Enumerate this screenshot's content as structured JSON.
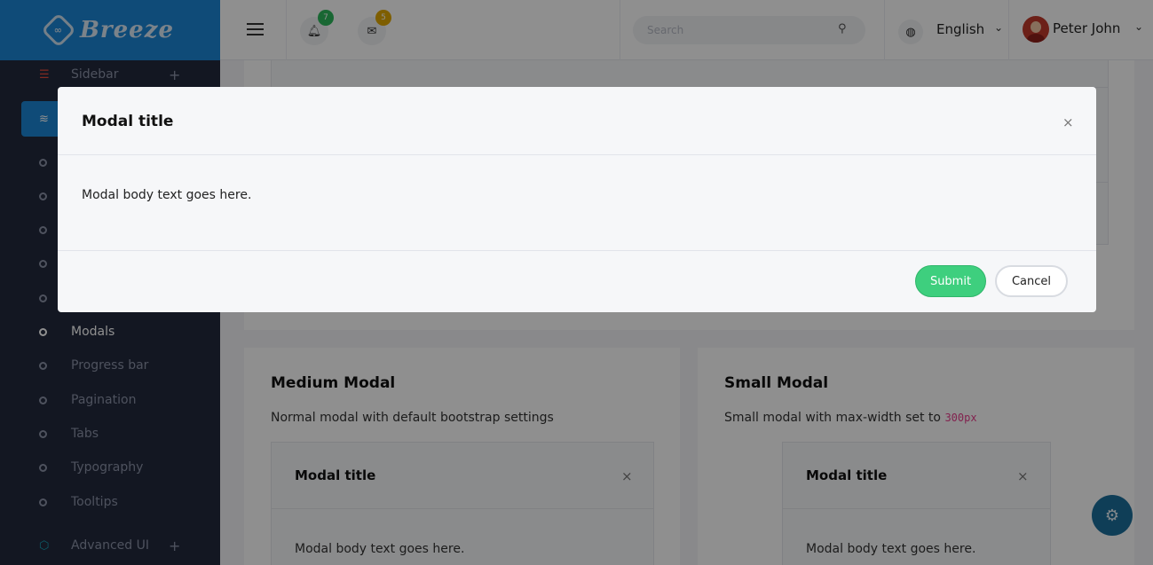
{
  "brand": {
    "name": "Breeze",
    "logo_glyph": "∞"
  },
  "sidebar": {
    "items": [
      {
        "label": "Sidebar",
        "icon": "list-icon",
        "expandable": true
      },
      {
        "label": "",
        "icon": "layers-icon",
        "active": true
      },
      {
        "label": ""
      },
      {
        "label": ""
      },
      {
        "label": ""
      },
      {
        "label": ""
      },
      {
        "label": ""
      },
      {
        "label": "Modals",
        "active": true
      },
      {
        "label": "Progress bar"
      },
      {
        "label": "Pagination"
      },
      {
        "label": "Tabs"
      },
      {
        "label": "Typography"
      },
      {
        "label": "Tooltips"
      },
      {
        "label": "Advanced UI",
        "icon": "cube-icon",
        "expandable": true
      }
    ]
  },
  "topbar": {
    "notifications": {
      "icon": "bell-icon",
      "count": "7",
      "badge_color": "#2eb85c"
    },
    "messages": {
      "icon": "mail-icon",
      "count": "5",
      "badge_color": "#e0a800"
    },
    "search": {
      "placeholder": "Search",
      "icon": "search-icon"
    },
    "language": {
      "icon": "globe-icon",
      "label": "English"
    },
    "user": {
      "name": "Peter John"
    }
  },
  "cards": {
    "medium": {
      "title": "Medium Modal",
      "description": "Normal modal with default bootstrap settings",
      "modal_title": "Modal title",
      "modal_body": "Modal body text goes here."
    },
    "small": {
      "title": "Small Modal",
      "description_prefix": "Small modal with max-width set to ",
      "description_code": "300px",
      "modal_title": "Modal title",
      "modal_body": "Modal body text goes here."
    }
  },
  "modal": {
    "title": "Modal title",
    "close": "×",
    "body": "Modal body text goes here.",
    "submit_label": "Submit",
    "cancel_label": "Cancel"
  },
  "colors": {
    "accent": "#1b87d6",
    "sidebar_bg": "#222a3e",
    "submit": "#3ecf7e"
  }
}
